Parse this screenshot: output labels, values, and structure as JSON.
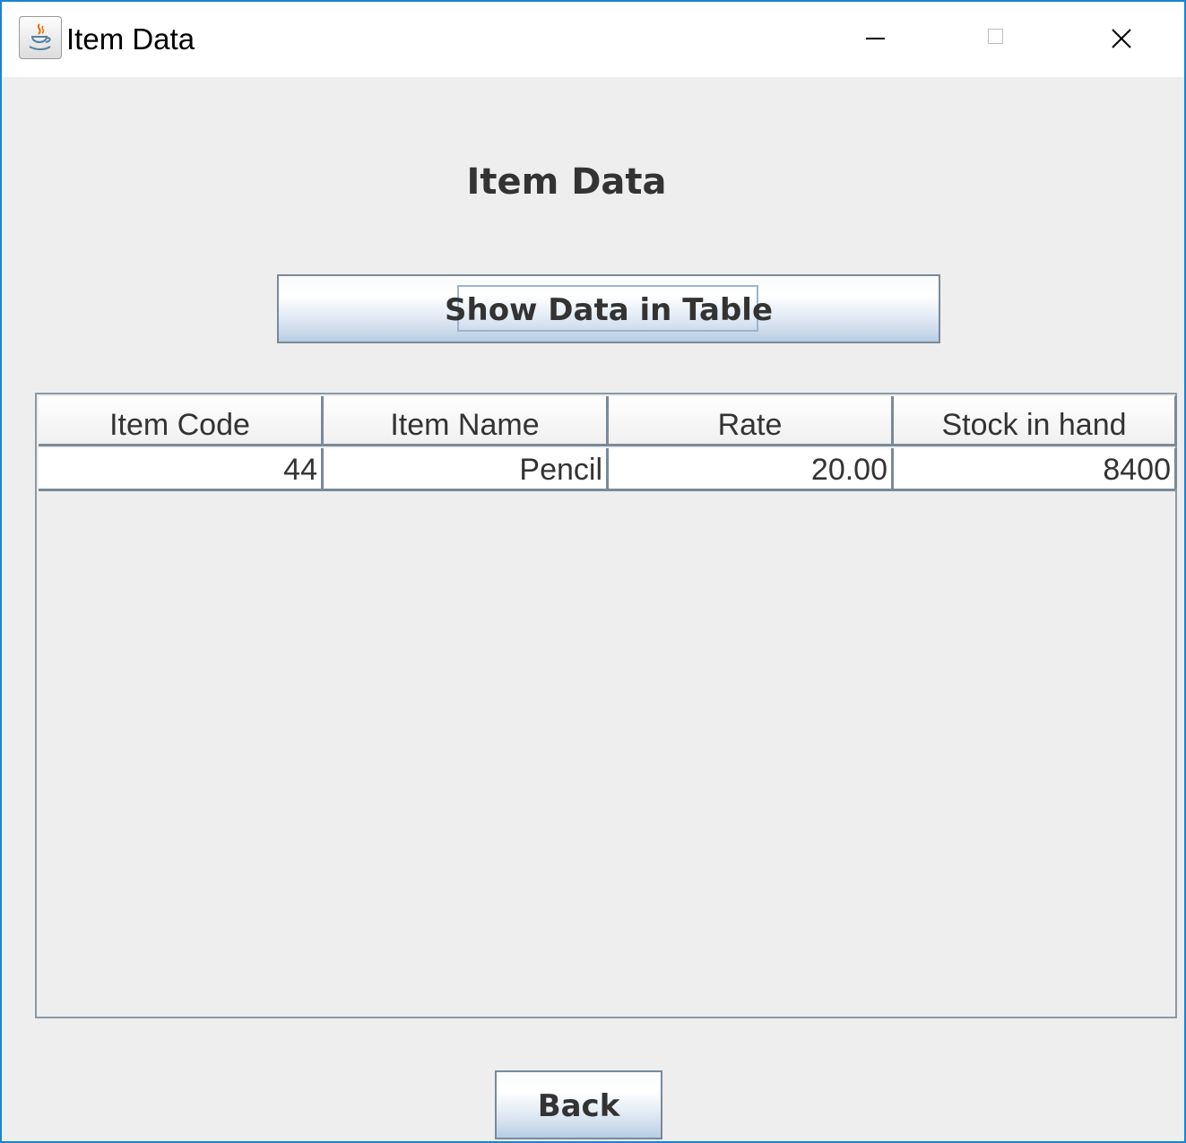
{
  "window": {
    "title": "Item Data",
    "icon": "java-cup-icon",
    "controls": [
      "minimize",
      "maximize",
      "close"
    ]
  },
  "heading": "Item Data",
  "show_button_label": "Show Data in Table",
  "table": {
    "columns": [
      "Item Code",
      "Item Name",
      "Rate",
      "Stock in hand"
    ],
    "rows": [
      [
        "44",
        "Pencil",
        "20.00",
        "8400"
      ]
    ]
  },
  "back_button_label": "Back",
  "colors": {
    "window_border": "#1883d7",
    "background": "#eeeeee",
    "text": "#333333"
  }
}
